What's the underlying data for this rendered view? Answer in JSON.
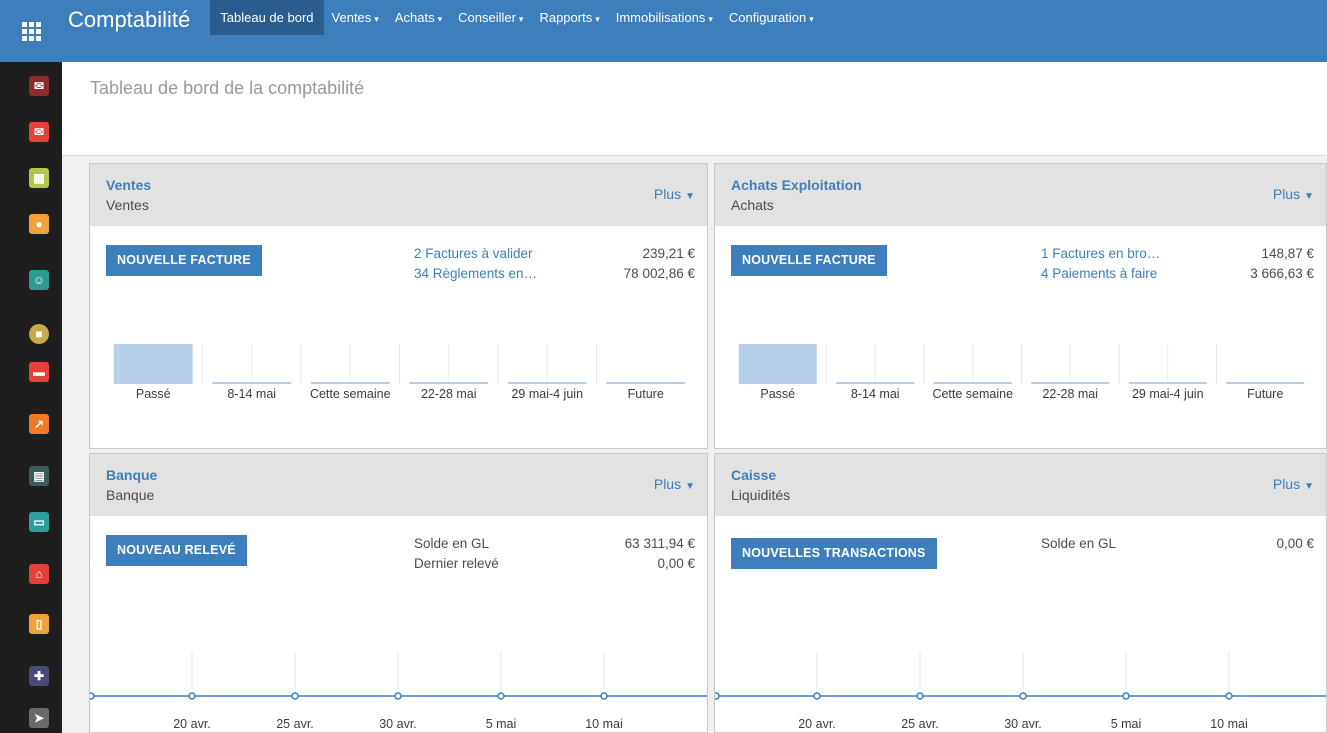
{
  "topbar": {
    "app_title": "Comptabilité",
    "menu": [
      {
        "label": "Tableau de bord",
        "active": true,
        "dropdown": false
      },
      {
        "label": "Ventes",
        "active": false,
        "dropdown": true
      },
      {
        "label": "Achats",
        "active": false,
        "dropdown": true
      },
      {
        "label": "Conseiller",
        "active": false,
        "dropdown": true
      },
      {
        "label": "Rapports",
        "active": false,
        "dropdown": true
      },
      {
        "label": "Immobilisations",
        "active": false,
        "dropdown": true
      },
      {
        "label": "Configuration",
        "active": false,
        "dropdown": true
      }
    ]
  },
  "apps_sidebar": [
    {
      "icon": "discuss-icon",
      "color": "#8b2d2d"
    },
    {
      "icon": "mail-icon",
      "color": "#e5413c"
    },
    {
      "icon": "calendar-icon",
      "color": "#b5c44a"
    },
    {
      "icon": "map-pin-icon",
      "color": "#f0a23c"
    },
    {
      "icon": "contacts-icon",
      "color": "#2d9b8e"
    },
    {
      "icon": "box-icon",
      "color": "#c9a94a"
    },
    {
      "icon": "folder-icon",
      "color": "#e5413c"
    },
    {
      "icon": "chart-icon",
      "color": "#f07b22"
    },
    {
      "icon": "spreadsheet-icon",
      "color": "#3c5c58"
    },
    {
      "icon": "card-icon",
      "color": "#2f9e9e"
    },
    {
      "icon": "building-icon",
      "color": "#e5413c"
    },
    {
      "icon": "document-icon",
      "color": "#f0a23c"
    },
    {
      "icon": "puzzle-icon",
      "color": "#4a4a7a"
    },
    {
      "icon": "send-icon",
      "color": "#6a6a6a"
    }
  ],
  "page": {
    "title": "Tableau de bord de la comptabilité"
  },
  "colors": {
    "brand": "#3d7fbd",
    "brand_dark": "#2a5d8f",
    "bar": "#b5cfe6",
    "line": "#3d7fbd"
  },
  "cards": {
    "ventes": {
      "title": "Ventes",
      "subtitle": "Ventes",
      "more": "Plus",
      "button": "NOUVELLE FACTURE",
      "stats": [
        {
          "label": "2 Factures à valider",
          "value": "239,21 €"
        },
        {
          "label": "34 Règlements en…",
          "value": "78 002,86 €"
        }
      ]
    },
    "achats": {
      "title": "Achats Exploitation",
      "subtitle": "Achats",
      "more": "Plus",
      "button": "NOUVELLE FACTURE",
      "stats": [
        {
          "label": "1 Factures en bro…",
          "value": "148,87 €"
        },
        {
          "label": "4 Paiements à faire",
          "value": "3 666,63 €"
        }
      ]
    },
    "banque": {
      "title": "Banque",
      "subtitle": "Banque",
      "more": "Plus",
      "button": "NOUVEAU RELEVÉ",
      "stats": [
        {
          "label": "Solde en GL",
          "value": "63 311,94 €"
        },
        {
          "label": "Dernier relevé",
          "value": "0,00 €"
        }
      ]
    },
    "caisse": {
      "title": "Caisse",
      "subtitle": "Liquidités",
      "more": "Plus",
      "button": "NOUVELLES TRANSACTIONS",
      "stats": [
        {
          "label": "Solde en GL",
          "value": "0,00 €"
        }
      ]
    }
  },
  "chart_data": [
    {
      "type": "bar",
      "panel": "Ventes",
      "categories": [
        "Passé",
        "8-14 mai",
        "Cette semaine",
        "22-28 mai",
        "29 mai-4 juin",
        "Future"
      ],
      "values": [
        1,
        0,
        0,
        0,
        0,
        0
      ]
    },
    {
      "type": "bar",
      "panel": "Achats Exploitation",
      "categories": [
        "Passé",
        "8-14 mai",
        "Cette semaine",
        "22-28 mai",
        "29 mai-4 juin",
        "Future"
      ],
      "values": [
        1,
        0,
        0,
        0,
        0,
        0
      ]
    },
    {
      "type": "line",
      "panel": "Banque",
      "x": [
        "20 avr.",
        "25 avr.",
        "30 avr.",
        "5 mai",
        "10 mai"
      ],
      "values": [
        0,
        0,
        0,
        0,
        0
      ]
    },
    {
      "type": "line",
      "panel": "Caisse",
      "x": [
        "20 avr.",
        "25 avr.",
        "30 avr.",
        "5 mai",
        "10 mai"
      ],
      "values": [
        0,
        0,
        0,
        0,
        0
      ]
    }
  ]
}
